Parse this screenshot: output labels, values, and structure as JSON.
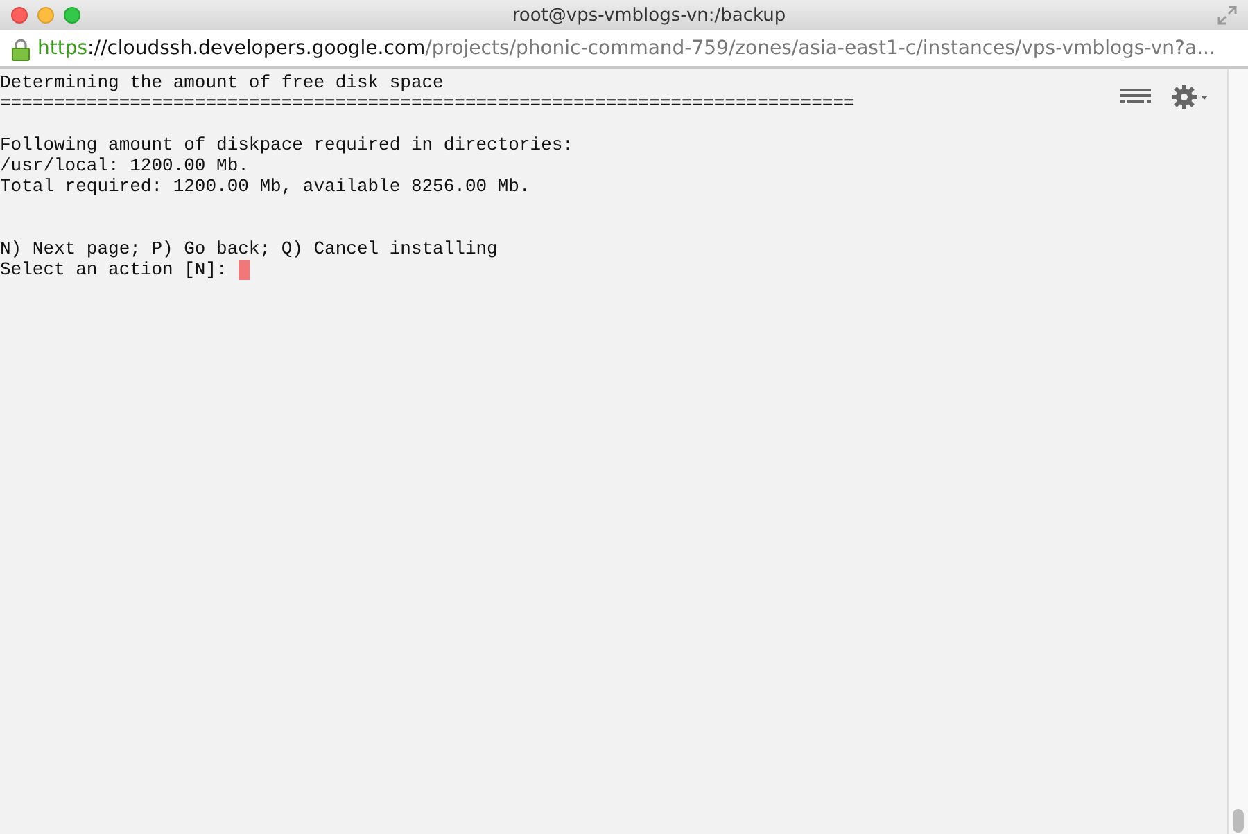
{
  "window": {
    "title": "root@vps-vmblogs-vn:/backup"
  },
  "address_bar": {
    "scheme": "https",
    "host": "://cloudssh.developers.google.com",
    "path": "/projects/phonic-command-759/zones/asia-east1-c/instances/vps-vmblogs-vn?a..."
  },
  "terminal": {
    "lines": [
      {
        "kind": "text",
        "text": "Determining the amount of free disk space"
      },
      {
        "kind": "text",
        "text": "==============================================================================="
      },
      {
        "kind": "blank"
      },
      {
        "kind": "text",
        "text": "Following amount of diskpace required in directories:"
      },
      {
        "kind": "text",
        "text": "/usr/local: 1200.00 Mb."
      },
      {
        "kind": "text",
        "text": "Total required: 1200.00 Mb, available 8256.00 Mb."
      },
      {
        "kind": "blank"
      },
      {
        "kind": "blank"
      },
      {
        "kind": "text",
        "text": "N) Next page; P) Go back; Q) Cancel installing"
      },
      {
        "kind": "prompt",
        "text": "Select an action [N]:"
      }
    ]
  }
}
